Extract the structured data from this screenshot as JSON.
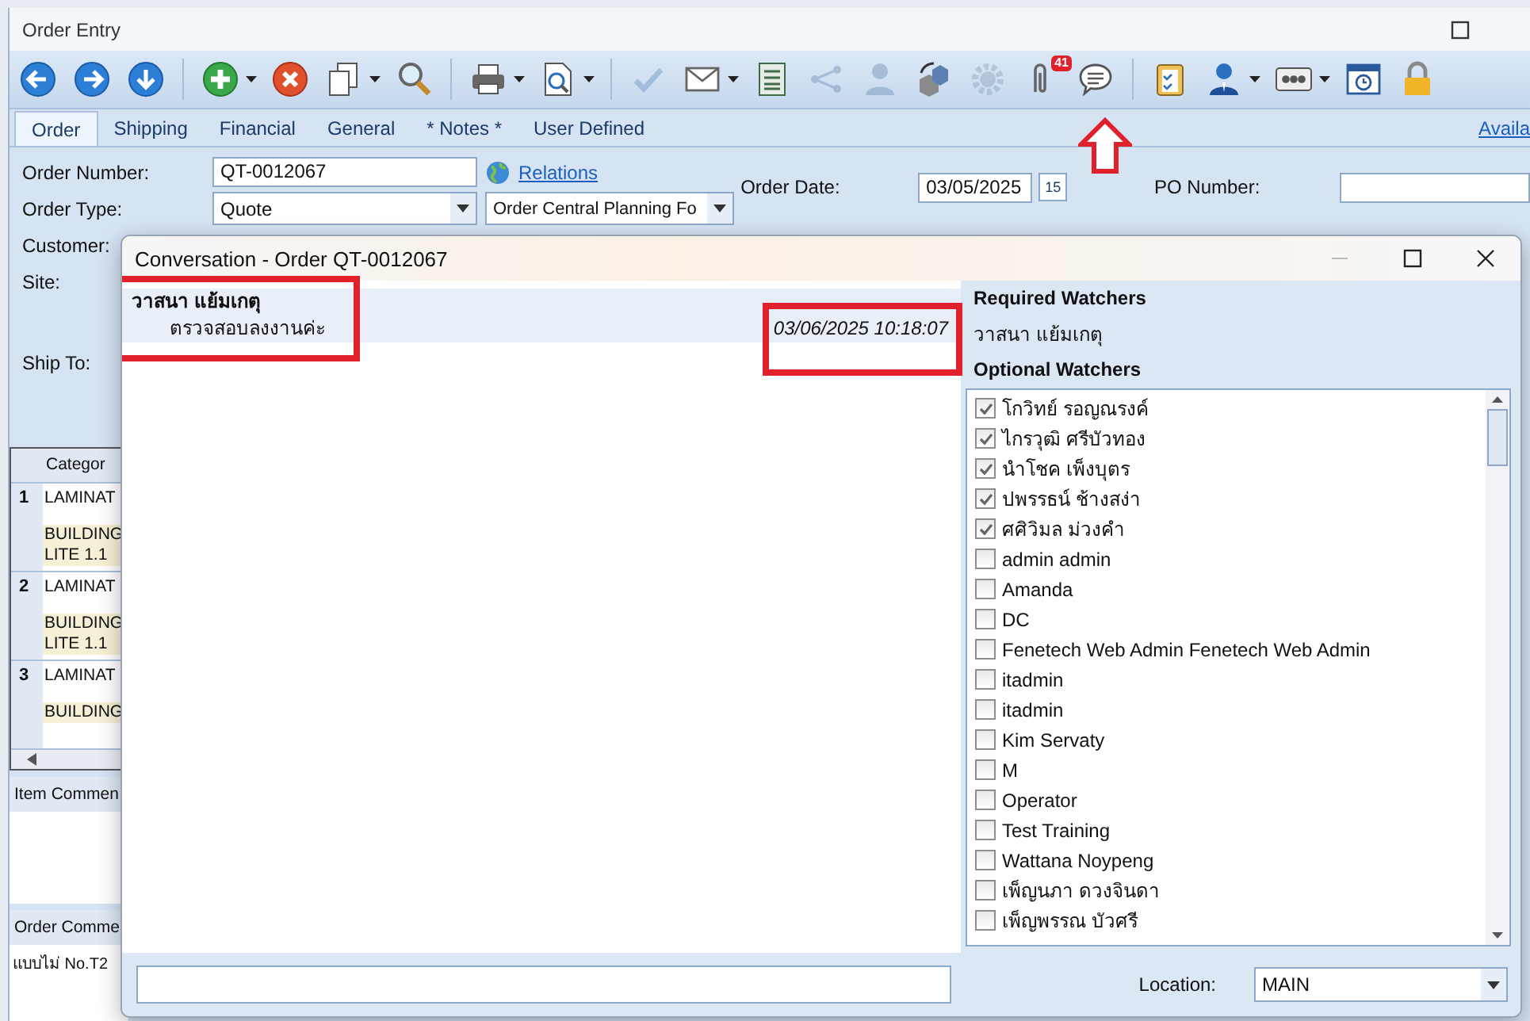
{
  "window": {
    "title": "Order Entry"
  },
  "toolbar": [
    {
      "kind": "back",
      "disabled": false,
      "dropdown": false
    },
    {
      "kind": "forward",
      "disabled": false,
      "dropdown": false
    },
    {
      "kind": "down",
      "disabled": false,
      "dropdown": false
    },
    {
      "kind": "separator"
    },
    {
      "kind": "add",
      "disabled": false,
      "dropdown": true
    },
    {
      "kind": "delete",
      "disabled": false,
      "dropdown": false
    },
    {
      "kind": "copy",
      "disabled": false,
      "dropdown": true
    },
    {
      "kind": "search",
      "disabled": false,
      "dropdown": false
    },
    {
      "kind": "separator"
    },
    {
      "kind": "print",
      "disabled": false,
      "dropdown": true
    },
    {
      "kind": "preview",
      "disabled": false,
      "dropdown": true
    },
    {
      "kind": "separator"
    },
    {
      "kind": "check",
      "disabled": true,
      "dropdown": false
    },
    {
      "kind": "mail",
      "disabled": false,
      "dropdown": true
    },
    {
      "kind": "list",
      "disabled": false,
      "dropdown": false
    },
    {
      "kind": "share",
      "disabled": true,
      "dropdown": false
    },
    {
      "kind": "person",
      "disabled": true,
      "dropdown": false
    },
    {
      "kind": "boxes",
      "disabled": false,
      "dropdown": false
    },
    {
      "kind": "gear",
      "disabled": true,
      "dropdown": false
    },
    {
      "kind": "paperclip",
      "disabled": false,
      "dropdown": false,
      "badge": "41"
    },
    {
      "kind": "chat",
      "disabled": false,
      "dropdown": false
    },
    {
      "kind": "separator"
    },
    {
      "kind": "clipboard",
      "disabled": false,
      "dropdown": false
    },
    {
      "kind": "user",
      "disabled": false,
      "dropdown": true
    },
    {
      "kind": "panel",
      "disabled": false,
      "dropdown": true
    },
    {
      "kind": "clock",
      "disabled": false,
      "dropdown": false
    },
    {
      "kind": "lock",
      "disabled": false,
      "dropdown": false
    }
  ],
  "tabs": [
    {
      "label": "Order",
      "selected": true
    },
    {
      "label": "Shipping",
      "selected": false
    },
    {
      "label": "Financial",
      "selected": false
    },
    {
      "label": "General",
      "selected": false
    },
    {
      "label": "* Notes *",
      "selected": false
    },
    {
      "label": "User Defined",
      "selected": false
    }
  ],
  "side_link": "Availa",
  "form": {
    "order_number_label": "Order Number:",
    "order_number": "QT-0012067",
    "relations_link": "Relations",
    "order_type_label": "Order Type:",
    "order_type": "Quote",
    "planning": "Order Central Planning Fo",
    "order_date_label": "Order Date:",
    "order_date": "03/05/2025",
    "calendar_day": "15",
    "po_number_label": "PO Number:",
    "customer_label": "Customer:",
    "site_label": "Site:",
    "ship_to_label": "Ship To:"
  },
  "grid": {
    "columns": [
      "Categor"
    ],
    "rows": [
      {
        "number": "1",
        "lines": [
          "LAMINAT",
          "BUILDING",
          "LITE 1.1"
        ]
      },
      {
        "number": "2",
        "lines": [
          "LAMINAT",
          "BUILDING",
          "LITE 1.1"
        ]
      },
      {
        "number": "3",
        "lines": [
          "LAMINAT",
          "BUILDING"
        ]
      }
    ]
  },
  "item_comments": {
    "label": "Item Commen"
  },
  "order_comments": {
    "label": "Order Comme",
    "text": "แบบไม่ No.T2"
  },
  "dialog": {
    "title": "Conversation - Order QT-0012067",
    "messages": [
      {
        "author": "วาสนา แย้มเกตุ",
        "text": "ตรวจสอบลงงานค่ะ",
        "time": "03/06/2025 10:18:07",
        "selected": true
      }
    ],
    "required_title": "Required Watchers",
    "required": [
      "วาสนา แย้มเกตุ"
    ],
    "optional_title": "Optional Watchers",
    "optional": [
      {
        "name": "โกวิทย์ รอญณรงค์",
        "checked": true
      },
      {
        "name": "ไกรวุฒิ ศรีบัวทอง",
        "checked": true
      },
      {
        "name": "นำโชค เพ็งบุตร",
        "checked": true
      },
      {
        "name": "ปพรรธน์ ช้างสง่า",
        "checked": true
      },
      {
        "name": "ศศิวิมล ม่วงคำ",
        "checked": true
      },
      {
        "name": "admin admin",
        "checked": false
      },
      {
        "name": "Amanda",
        "checked": false
      },
      {
        "name": "DC",
        "checked": false
      },
      {
        "name": "Fenetech Web Admin Fenetech Web Admin",
        "checked": false
      },
      {
        "name": "itadmin",
        "checked": false
      },
      {
        "name": "itadmin",
        "checked": false
      },
      {
        "name": "Kim Servaty",
        "checked": false
      },
      {
        "name": "M",
        "checked": false
      },
      {
        "name": "Operator",
        "checked": false
      },
      {
        "name": "Test Training",
        "checked": false
      },
      {
        "name": "Wattana Noypeng",
        "checked": false
      },
      {
        "name": "เพ็ญนภา ดวงจินดา",
        "checked": false
      },
      {
        "name": "เพ็ญพรรณ บัวศรี",
        "checked": false
      }
    ],
    "location_label": "Location:",
    "location": "MAIN"
  }
}
